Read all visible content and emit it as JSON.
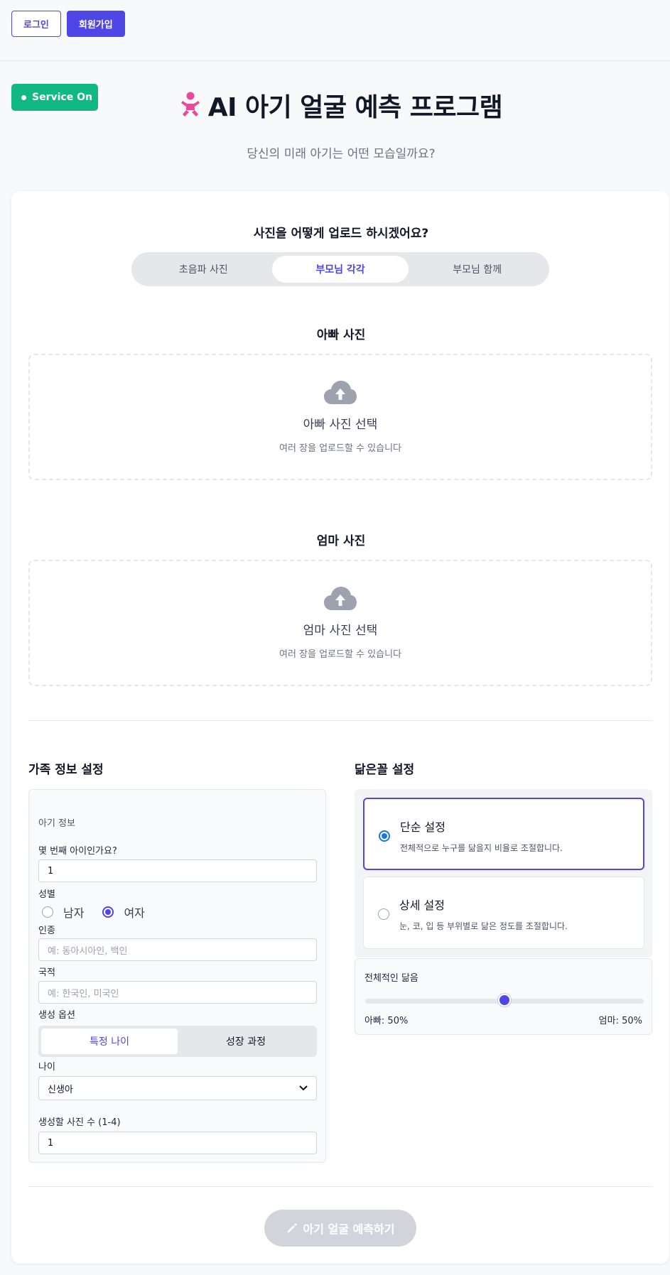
{
  "auth": {
    "login_label": "로그인",
    "signup_label": "회원가입"
  },
  "status": {
    "label": "Service On",
    "color": "#10b981"
  },
  "header": {
    "icon": "baby-icon",
    "title": "AI 아기 얼굴 예측 프로그램",
    "subtitle": "당신의 미래 아기는 어떤 모습일까요?"
  },
  "upload": {
    "question": "사진을 어떻게 업로드 하시겠어요?",
    "modes": [
      "초음파 사진",
      "부모님 각각",
      "부모님 함께"
    ],
    "active_mode": "부모님 각각",
    "father": {
      "heading": "아빠 사진",
      "title": "아빠 사진 선택",
      "hint": "여러 장을 업로드할 수 있습니다"
    },
    "mother": {
      "heading": "엄마 사진",
      "title": "엄마 사진 선택",
      "hint": "여러 장을 업로드할 수 있습니다"
    }
  },
  "family": {
    "heading": "가족 정보 설정",
    "section_label": "아기 정보",
    "order_label": "몇 번째 아이인가요?",
    "order_value": "1",
    "gender_label": "성별",
    "gender_options": [
      "남자",
      "여자"
    ],
    "gender_selected": "여자",
    "ethnicity_label": "인종",
    "ethnicity_placeholder": "예: 동아시아인, 백인",
    "nationality_label": "국적",
    "nationality_placeholder": "예: 한국인, 미국인",
    "gen_option_label": "생성 옵션",
    "gen_options": [
      "특정 나이",
      "성장 과정"
    ],
    "gen_option_selected": "특정 나이",
    "age_label": "나이",
    "age_value": "신생아",
    "count_label": "생성할 사진 수 (1-4)",
    "count_value": "1"
  },
  "similarity": {
    "heading": "닮은꼴 설정",
    "options": [
      {
        "title": "단순 설정",
        "desc": "전체적으로 누구를 닮을지 비율로 조절합니다.",
        "selected": true
      },
      {
        "title": "상세 설정",
        "desc": "눈, 코, 입 등 부위별로 닮은 정도를 조절합니다.",
        "selected": false
      }
    ],
    "slider_label": "전체적인 닮음",
    "father_label": "아빠: 50%",
    "mother_label": "엄마: 50%",
    "slider_value": 0.5
  },
  "predict_button": "아기 얼굴 예측하기",
  "colors": {
    "accent": "#4f46e5",
    "baby_icon": "#ec4899",
    "disabled": "#d1d5db"
  }
}
